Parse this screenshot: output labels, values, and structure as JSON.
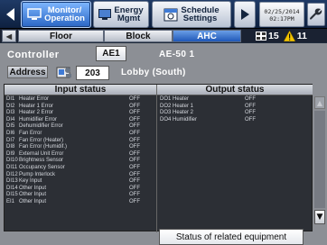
{
  "nav": {
    "monitor": "Monitor/\nOperation",
    "energy": "Energy\nMgmt",
    "schedule": "Schedule\nSettings",
    "clock_date": "02/25/2014",
    "clock_time": "02:17PM"
  },
  "tabs": {
    "floor": "Floor",
    "block": "Block",
    "ahc": "AHC"
  },
  "counts": {
    "on": "15",
    "alert": "11"
  },
  "controller": {
    "label": "Controller",
    "id": "AE1",
    "name": "AE-50 1"
  },
  "address": {
    "label": "Address",
    "value": "203",
    "name": "Lobby (South)"
  },
  "input_status": {
    "title": "Input status",
    "rows": [
      {
        "code": "DI1",
        "name": "Heater Error",
        "value": "OFF"
      },
      {
        "code": "DI2",
        "name": "Heater 1 Error",
        "value": "OFF"
      },
      {
        "code": "DI3",
        "name": "Heater 2 Error",
        "value": "OFF"
      },
      {
        "code": "DI4",
        "name": "Humidifier Error",
        "value": "OFF"
      },
      {
        "code": "DI5",
        "name": "Dehumidifier Error",
        "value": "OFF"
      },
      {
        "code": "DI6",
        "name": "Fan Error",
        "value": "OFF"
      },
      {
        "code": "DI7",
        "name": "Fan Error (Heater)",
        "value": "OFF"
      },
      {
        "code": "DI8",
        "name": "Fan Error (Humidif.)",
        "value": "OFF"
      },
      {
        "code": "DI9",
        "name": "External Unit Error",
        "value": "OFF"
      },
      {
        "code": "DI10",
        "name": "Brightness Sensor",
        "value": "OFF"
      },
      {
        "code": "DI11",
        "name": "Occupancy Sensor",
        "value": "OFF"
      },
      {
        "code": "DI12",
        "name": "Pump Interlock",
        "value": "OFF"
      },
      {
        "code": "DI13",
        "name": "Key Input",
        "value": "OFF"
      },
      {
        "code": "DI14",
        "name": "Other Input",
        "value": "OFF"
      },
      {
        "code": "DI15",
        "name": "Other Input",
        "value": "OFF"
      },
      {
        "code": "EI1",
        "name": "Other Input",
        "value": "OFF"
      }
    ]
  },
  "output_status": {
    "title": "Output status",
    "rows": [
      {
        "code": "DO1",
        "name": "Heater",
        "value": "OFF"
      },
      {
        "code": "DO2",
        "name": "Heater 1",
        "value": "OFF"
      },
      {
        "code": "DO3",
        "name": "Heater 2",
        "value": "OFF"
      },
      {
        "code": "DO4",
        "name": "Humidifier",
        "value": "OFF"
      }
    ]
  },
  "related_button": "Status of related equipment",
  "colors": {
    "accent": "#2a66c4",
    "panel": "#8c8f95",
    "alert": "#f2c400"
  },
  "icons": [
    "back-arrow-icon",
    "monitor-icon",
    "energy-icon",
    "schedule-icon",
    "play-icon",
    "wrench-icon",
    "group-icon",
    "alert-icon",
    "address-book-icon"
  ]
}
